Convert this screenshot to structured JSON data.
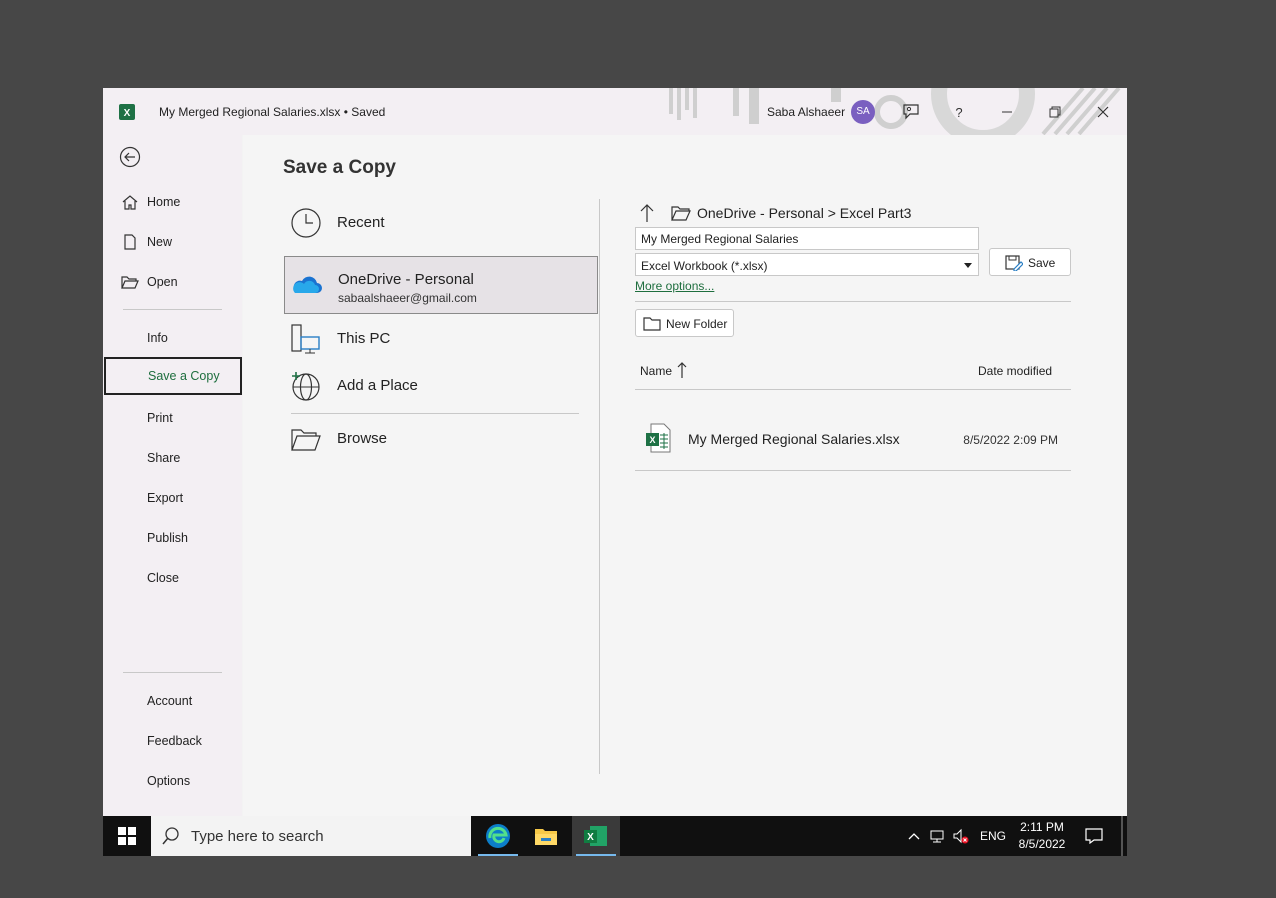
{
  "titlebar": {
    "doc_title": "My Merged Regional Salaries.xlsx • Saved",
    "user_name": "Saba Alshaeer",
    "avatar_initials": "SA",
    "help_label": "?"
  },
  "nav": {
    "items": [
      {
        "label": "Home",
        "icon": "home-icon"
      },
      {
        "label": "New",
        "icon": "new-document-icon"
      },
      {
        "label": "Open",
        "icon": "open-folder-icon"
      },
      {
        "label": "Info"
      },
      {
        "label": "Save a Copy",
        "selected": true
      },
      {
        "label": "Print"
      },
      {
        "label": "Share"
      },
      {
        "label": "Export"
      },
      {
        "label": "Publish"
      },
      {
        "label": "Close"
      },
      {
        "label": "Account"
      },
      {
        "label": "Feedback"
      },
      {
        "label": "Options"
      }
    ]
  },
  "main": {
    "title": "Save a Copy",
    "locations": [
      {
        "label": "Recent",
        "icon": "clock-icon"
      },
      {
        "label": "OneDrive - Personal",
        "sub": "sabaalshaeer@gmail.com",
        "icon": "onedrive-cloud-icon",
        "selected": true
      },
      {
        "label": "This PC",
        "icon": "pc-icon"
      },
      {
        "label": "Add a Place",
        "icon": "globe-add-icon"
      },
      {
        "label": "Browse",
        "icon": "browse-folder-icon"
      }
    ]
  },
  "save_panel": {
    "path": "OneDrive - Personal > Excel Part3",
    "filename": "My Merged Regional Salaries",
    "filetype": "Excel Workbook (*.xlsx)",
    "save_label": "Save",
    "more_options": "More options...",
    "new_folder": "New Folder",
    "col_name": "Name",
    "col_date": "Date modified",
    "files": [
      {
        "name": "My Merged Regional Salaries.xlsx",
        "date": "8/5/2022 2:09 PM"
      }
    ]
  },
  "taskbar": {
    "search_placeholder": "Type here to search",
    "lang": "ENG",
    "time": "2:11 PM",
    "date": "8/5/2022"
  },
  "colors": {
    "excel_green": "#1e6e3e",
    "avatar": "#7a5fc0",
    "taskbar": "#101010"
  }
}
